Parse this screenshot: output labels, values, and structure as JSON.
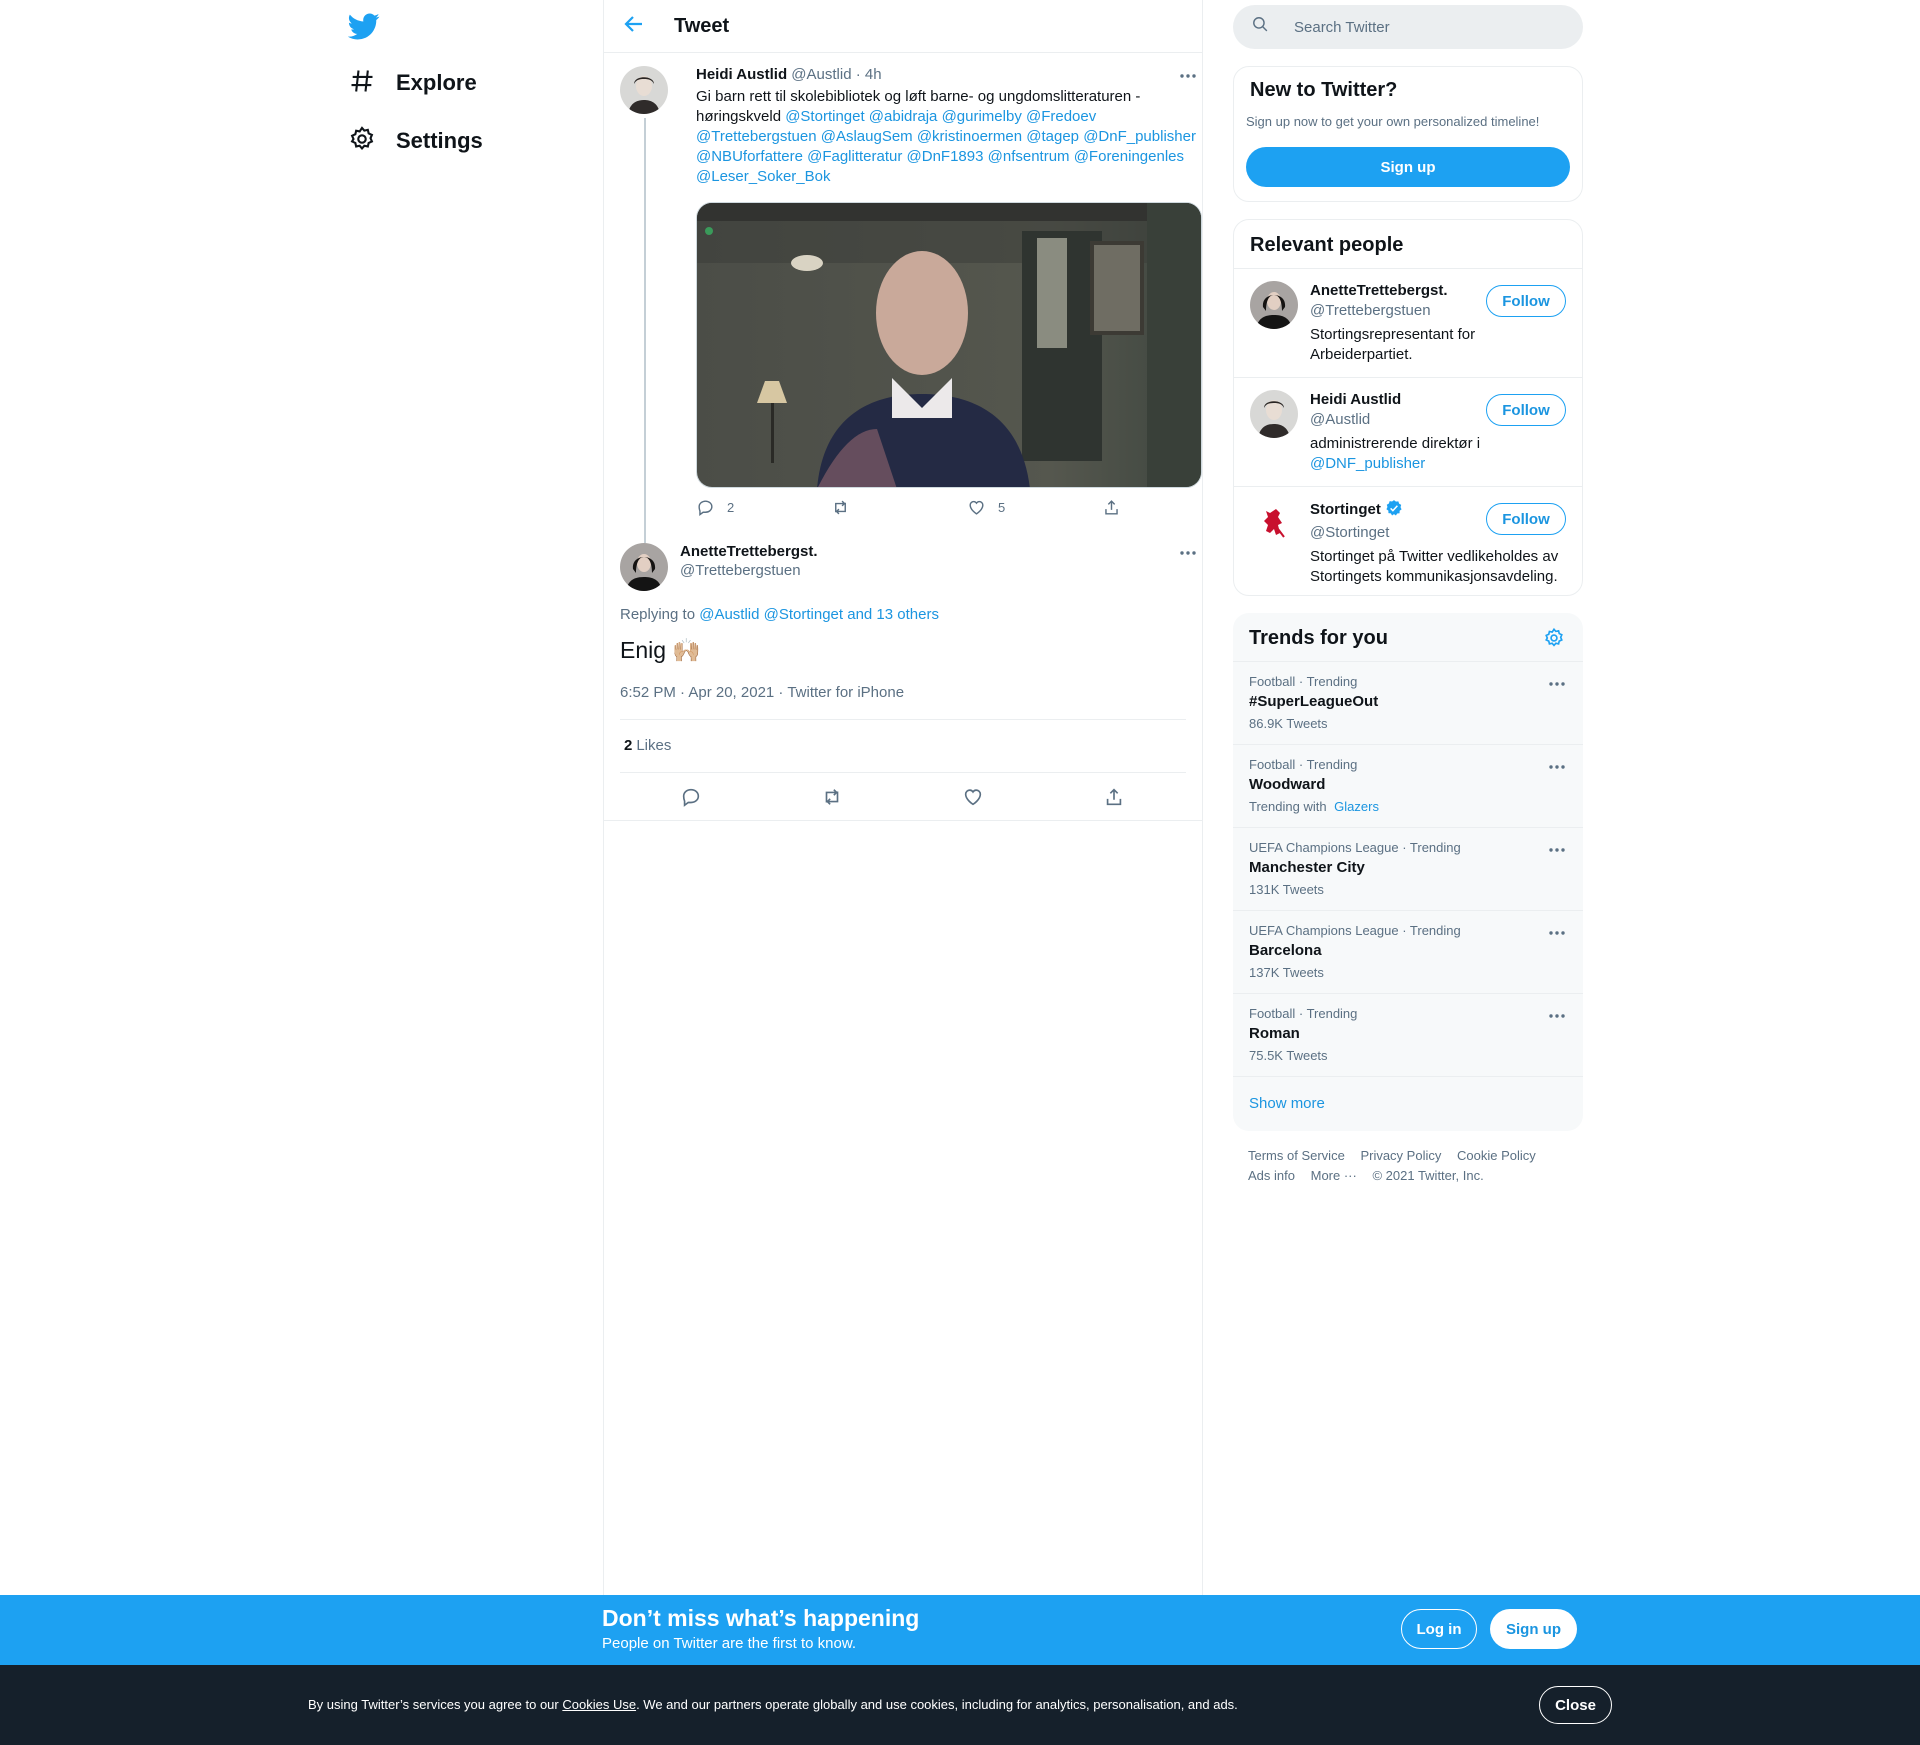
{
  "nav": {
    "explore": "Explore",
    "settings": "Settings"
  },
  "header": {
    "title": "Tweet"
  },
  "parent_tweet": {
    "name": "Heidi Austlid",
    "handle": "@Austlid",
    "age": "· 4h",
    "text": "Gi barn rett til skolebibliotek og løft barne- og ungdomslitteraturen - høringskveld ",
    "mentions": "@Stortinget @abidraja @gurimelby @Fredoev @Trettebergstuen @AslaugSem @kristinoermen @tagep @DnF_publisher @NBUforfattere @Faglitteratur @DnF1893 @nfsentrum @Foreningenles @Leser_Soker_Bok",
    "replies": "2",
    "likes": "5"
  },
  "focus_tweet": {
    "name": "AnetteTrettebergst.",
    "handle": "@Trettebergstuen",
    "replying_label": "Replying to",
    "replying_to": "@Austlid @Stortinget and 13 others",
    "text": "Enig 🙌🏼",
    "timestamp": "6:52 PM · Apr 20, 2021 · Twitter for iPhone",
    "likes_count": "2",
    "likes_label": "Likes"
  },
  "search": {
    "placeholder": "Search Twitter"
  },
  "new_to_twitter": {
    "title": "New to Twitter?",
    "subtitle": "Sign up now to get your own personalized timeline!",
    "button": "Sign up"
  },
  "relevant": {
    "title": "Relevant people",
    "people": [
      {
        "name": "AnetteTrettebergst.",
        "handle": "@Trettebergstuen",
        "bio": "Stortingsrepresentant for Arbeiderpartiet.",
        "bio_link": "",
        "follow": "Follow"
      },
      {
        "name": "Heidi Austlid",
        "handle": "@Austlid",
        "bio": "administrerende direktør i ",
        "bio_link": "@DNF_publisher",
        "follow": "Follow"
      },
      {
        "name": "Stortinget",
        "handle": "@Stortinget",
        "bio": "Stortinget på Twitter vedlikeholdes av Stortingets kommunikasjonsavdeling.",
        "bio_link": "",
        "follow": "Follow"
      }
    ]
  },
  "trends": {
    "title": "Trends for you",
    "items": [
      {
        "context": "Football · Trending",
        "name": "#SuperLeagueOut",
        "count": "86.9K Tweets"
      },
      {
        "context": "Football · Trending",
        "name": "Woodward",
        "count": "Trending with ",
        "count_link": "Glazers"
      },
      {
        "context": "UEFA Champions League · Trending",
        "name": "Manchester City",
        "count": "131K Tweets"
      },
      {
        "context": "UEFA Champions League · Trending",
        "name": "Barcelona",
        "count": "137K Tweets"
      },
      {
        "context": "Football · Trending",
        "name": "Roman",
        "count": "75.5K Tweets"
      }
    ],
    "show_more": "Show more"
  },
  "footer": {
    "terms": "Terms of Service",
    "privacy": "Privacy Policy",
    "cookie": "Cookie Policy",
    "ads": "Ads info",
    "more": "More ···",
    "copyright": "© 2021 Twitter, Inc."
  },
  "banner": {
    "title": "Don’t miss what’s happening",
    "subtitle": "People on Twitter are the first to know.",
    "login": "Log in",
    "signup": "Sign up"
  },
  "cookie": {
    "pre": "By using Twitter’s services you agree to our ",
    "link": "Cookies Use",
    "post": ". We and our partners operate globally and use cookies, including for analytics, personalisation, and ads.",
    "close": "Close"
  },
  "colors": {
    "accent": "#1da1f2",
    "link": "#1b95e0",
    "cookie_bg": "#15202b"
  }
}
